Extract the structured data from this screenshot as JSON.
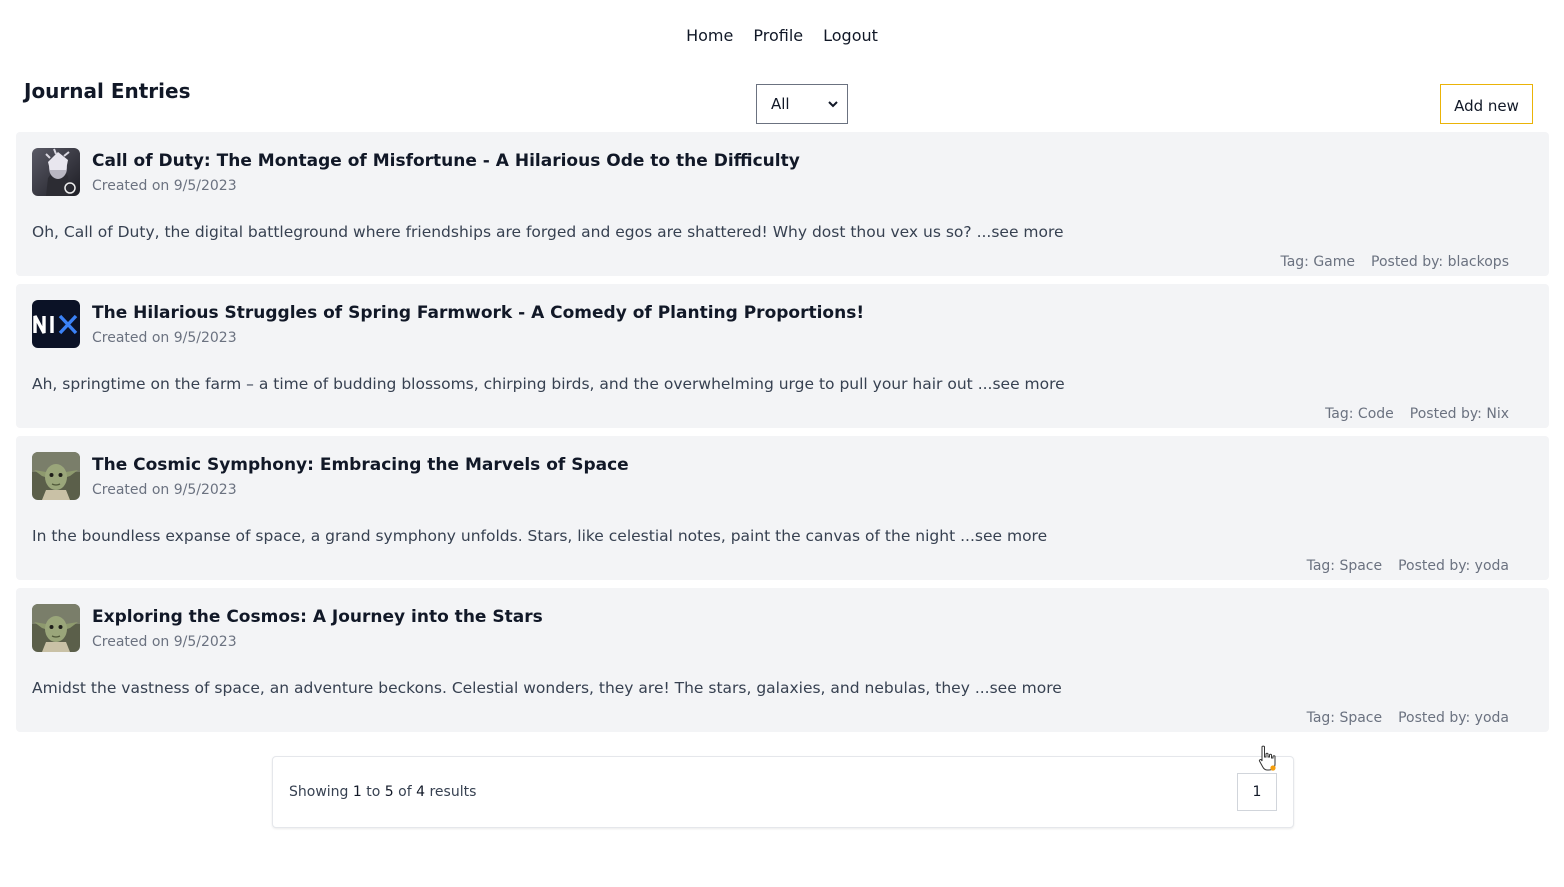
{
  "nav": {
    "home": "Home",
    "profile": "Profile",
    "logout": "Logout"
  },
  "header": {
    "title": "Journal Entries",
    "filter_value": "All",
    "add_label": "Add new"
  },
  "entries": [
    {
      "title": "Call of Duty: The Montage of Misfortune - A Hilarious Ode to the Difficulty",
      "date": "Created on 9/5/2023",
      "excerpt": "Oh, Call of Duty, the digital battleground where friendships are forged and egos are shattered! Why dost thou vex us so?",
      "see_more": "...see more",
      "tag": "Tag: Game",
      "author": "Posted by: blackops",
      "avatar": "soldier-avatar"
    },
    {
      "title": "The Hilarious Struggles of Spring Farmwork - A Comedy of Planting Proportions!",
      "date": "Created on 9/5/2023",
      "excerpt": "Ah, springtime on the farm – a time of budding blossoms, chirping birds, and the overwhelming urge to pull your hair out",
      "see_more": "...see more",
      "tag": "Tag: Code",
      "author": "Posted by: Nix",
      "avatar": "nix-logo-avatar"
    },
    {
      "title": "The Cosmic Symphony: Embracing the Marvels of Space",
      "date": "Created on 9/5/2023",
      "excerpt": "In the boundless expanse of space, a grand symphony unfolds. Stars, like celestial notes, paint the canvas of the night",
      "see_more": "...see more",
      "tag": "Tag: Space",
      "author": "Posted by: yoda",
      "avatar": "yoda-avatar"
    },
    {
      "title": "Exploring the Cosmos: A Journey into the Stars",
      "date": "Created on 9/5/2023",
      "excerpt": "Amidst the vastness of space, an adventure beckons. Celestial wonders, they are! The stars, galaxies, and nebulas, they",
      "see_more": "...see more",
      "tag": "Tag: Space",
      "author": "Posted by: yoda",
      "avatar": "yoda-avatar"
    }
  ],
  "pagination": {
    "prefix": "Showing",
    "from": "1",
    "to_word": "to",
    "to": "5",
    "of_word": "of",
    "total": "4",
    "suffix": "results",
    "page": "1"
  }
}
